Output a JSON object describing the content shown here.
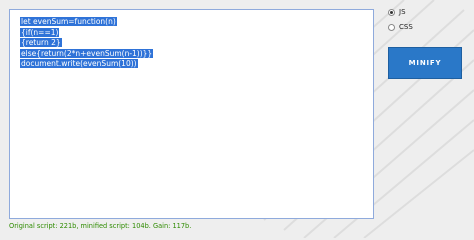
{
  "editor": {
    "lines": [
      "let evenSum=function(n)",
      "{if(n==1)",
      "{return 2}",
      "else{return(2*n+evenSum(n-1))}}",
      "document.write(evenSum(10))"
    ]
  },
  "options": {
    "js_label": "JS",
    "css_label": "CSS",
    "selected": "JS"
  },
  "minify_button": {
    "label": "MINIFY"
  },
  "status": {
    "text": "Original script: 221b, minified script: 104b. Gain: 117b."
  },
  "colors": {
    "selection": "#2f73d8",
    "button": "#2a78c8",
    "status_text": "#2e8b00"
  }
}
